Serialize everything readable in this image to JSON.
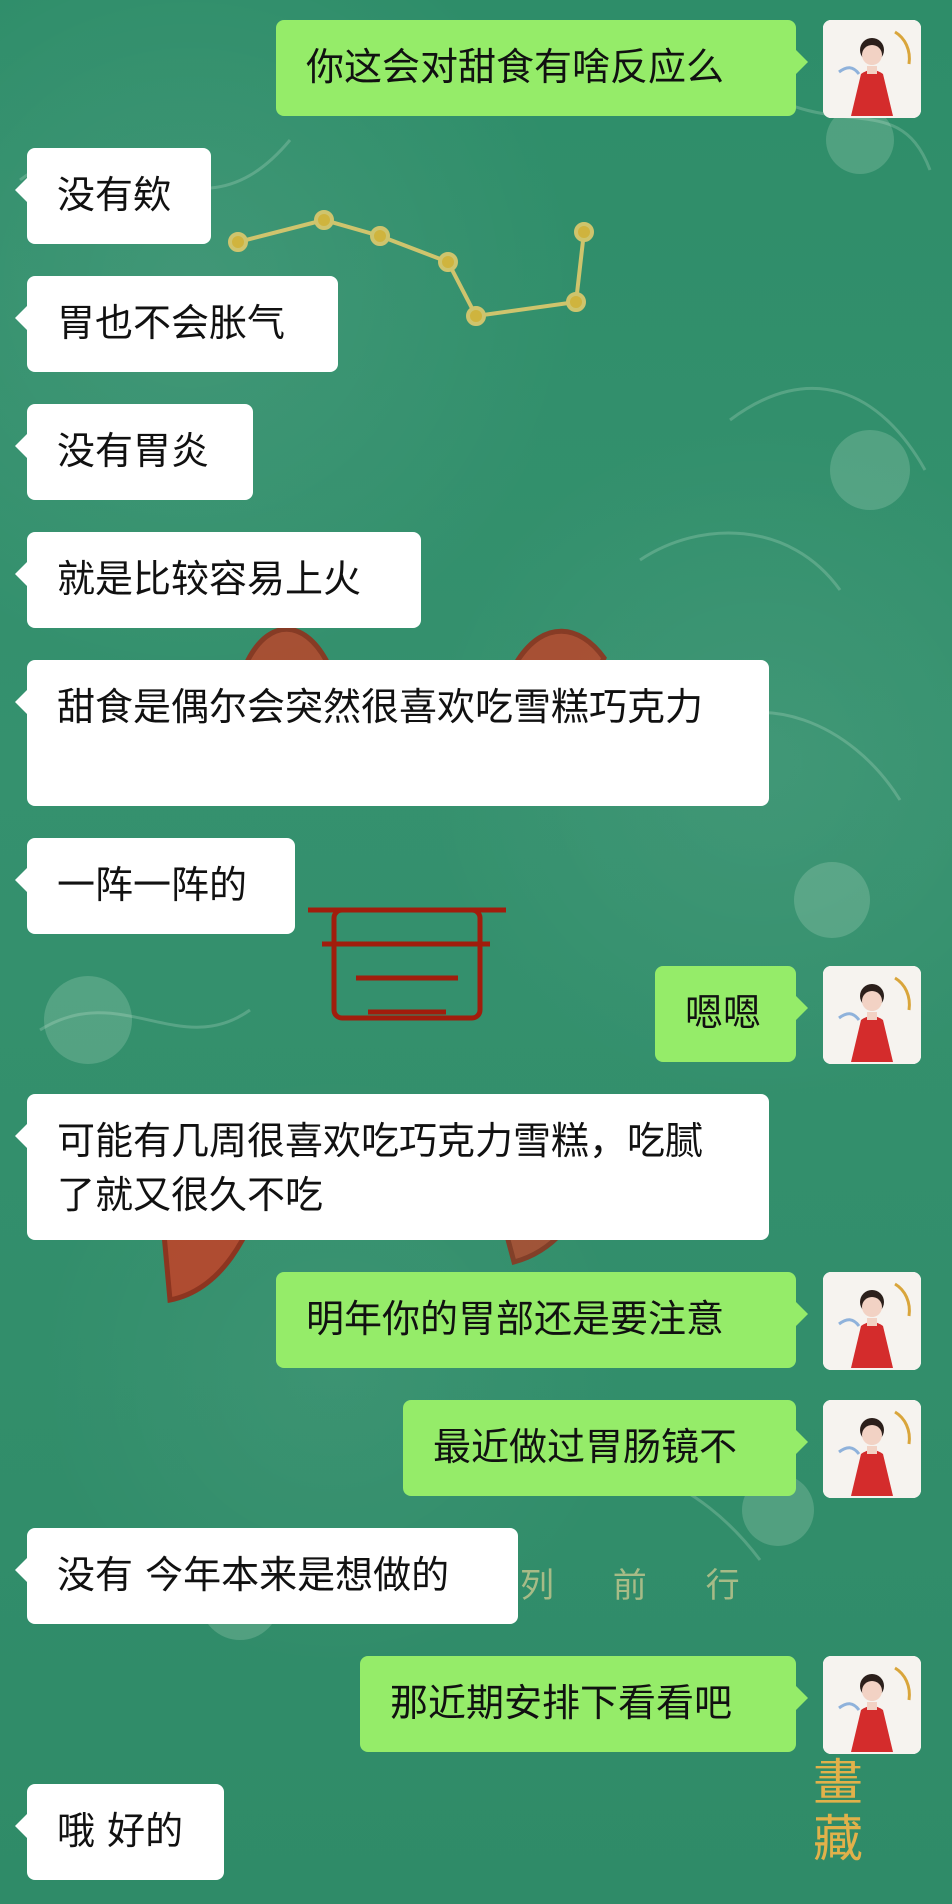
{
  "messages": [
    {
      "side": "right",
      "text": "你这会对甜食有啥反应么",
      "avatar": "profile-avatar"
    },
    {
      "side": "left",
      "text": "没有欸"
    },
    {
      "side": "left",
      "text": "胃也不会胀气"
    },
    {
      "side": "left",
      "text": "没有胃炎"
    },
    {
      "side": "left",
      "text": "就是比较容易上火"
    },
    {
      "side": "left",
      "text": "甜食是偶尔会突然很喜欢吃雪糕巧克力"
    },
    {
      "side": "left",
      "text": "一阵一阵的"
    },
    {
      "side": "right",
      "text": "嗯嗯",
      "avatar": "profile-avatar"
    },
    {
      "side": "left",
      "text": "可能有几周很喜欢吃巧克力雪糕，吃腻了就又很久不吃"
    },
    {
      "side": "right",
      "text": "明年你的胃部还是要注意",
      "avatar": "profile-avatar"
    },
    {
      "side": "right",
      "text": "最近做过胃肠镜不",
      "avatar": "profile-avatar"
    },
    {
      "side": "left",
      "text": "没有 今年本来是想做的"
    },
    {
      "side": "right",
      "text": "那近期安排下看看吧",
      "avatar": "profile-avatar"
    },
    {
      "side": "left",
      "text": "哦 好的"
    }
  ],
  "background": {
    "watermark_text": "列 前 行",
    "vertical_text": "畫藏"
  },
  "colors": {
    "outgoing": "#95ec69",
    "incoming": "#ffffff",
    "background": "#2f8f6a"
  }
}
